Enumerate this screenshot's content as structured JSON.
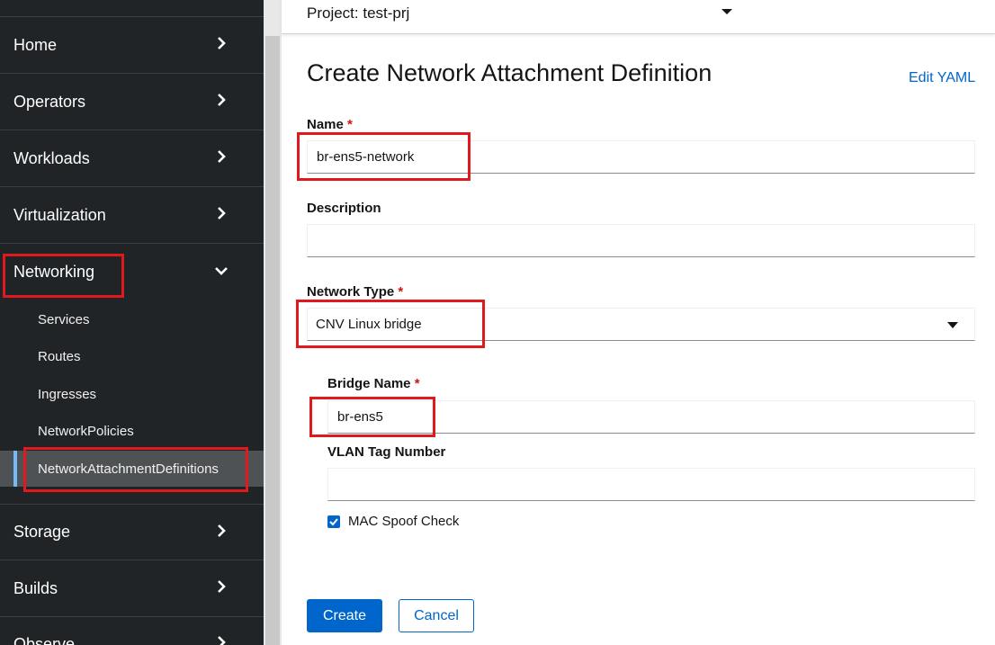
{
  "sidebar": {
    "sections": [
      {
        "label": "Home",
        "expanded": false
      },
      {
        "label": "Operators",
        "expanded": false
      },
      {
        "label": "Workloads",
        "expanded": false
      },
      {
        "label": "Virtualization",
        "expanded": false
      },
      {
        "label": "Networking",
        "expanded": true
      },
      {
        "label": "Storage",
        "expanded": false
      },
      {
        "label": "Builds",
        "expanded": false
      },
      {
        "label": "Observe",
        "expanded": false
      }
    ],
    "networking_items": [
      {
        "label": "Services"
      },
      {
        "label": "Routes"
      },
      {
        "label": "Ingresses"
      },
      {
        "label": "NetworkPolicies"
      },
      {
        "label": "NetworkAttachmentDefinitions",
        "active": true
      }
    ]
  },
  "project_bar": {
    "label": "Project: test-prj"
  },
  "main": {
    "title": "Create Network Attachment Definition",
    "edit_yaml": "Edit YAML",
    "name": {
      "label": "Name",
      "required": "*",
      "value": "br-ens5-network"
    },
    "description": {
      "label": "Description",
      "value": ""
    },
    "network_type": {
      "label": "Network Type",
      "required": "*",
      "selected": "CNV Linux bridge"
    },
    "bridge_name": {
      "label": "Bridge Name",
      "required": "*",
      "value": "br-ens5"
    },
    "vlan": {
      "label": "VLAN Tag Number",
      "value": ""
    },
    "mac_spoof": {
      "label": "MAC Spoof Check",
      "checked": true
    },
    "create_label": "Create",
    "cancel_label": "Cancel"
  },
  "colors": {
    "sidebar_bg": "#212427",
    "accent": "#0066cc",
    "highlight": "#e0191f",
    "required": "#c9190b"
  },
  "icons": [
    "chevron-right-icon",
    "chevron-down-icon",
    "caret-down-icon",
    "checkmark-icon"
  ]
}
